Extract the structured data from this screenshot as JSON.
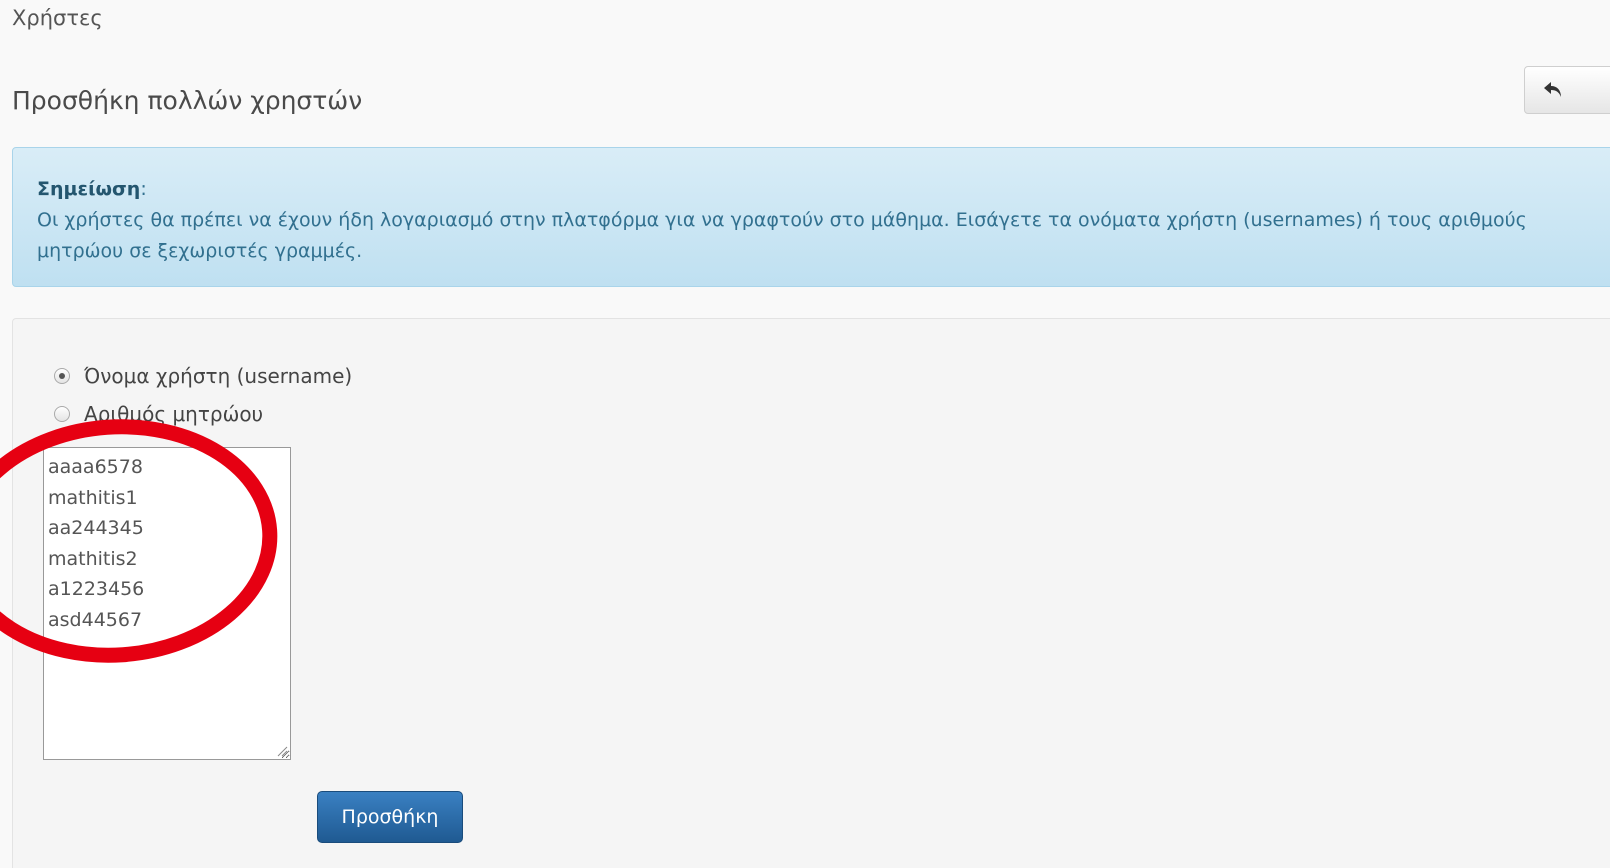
{
  "breadcrumb": {
    "label": "Χρήστες"
  },
  "header": {
    "title": "Προσθήκη πολλών χρηστών",
    "back_icon": "undo-arrow-icon"
  },
  "note": {
    "label": "Σημείωση",
    "separator": ":",
    "text": "Οι χρήστες θα πρέπει να έχουν ήδη λογαριασμό στην πλατφόρμα για να γραφτούν στο μάθημα. Εισάγετε τα ονόματα χρήστη (usernames) ή τους αριθμούς μητρώου σε ξεχωριστές γραμμές."
  },
  "form": {
    "options": [
      {
        "label": "Όνομα χρήστη (username)",
        "checked": true
      },
      {
        "label": "Αριθμός μητρώου",
        "checked": false
      }
    ],
    "user_list": {
      "lines": [
        "aaaa6578",
        "mathitis1",
        "aa244345",
        "mathitis2",
        "a1223456",
        "asd44567"
      ]
    },
    "submit_label": "Προσθήκη"
  },
  "colors": {
    "annotation_circle": "#e60012",
    "primary_button": "#2a6ead",
    "alert_bg": "#d9edf7"
  }
}
